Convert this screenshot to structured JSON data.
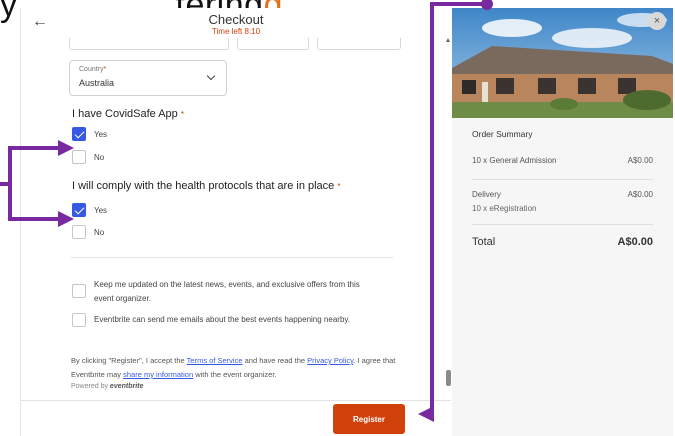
{
  "caption": {
    "pre": "y",
    "mid": "tering",
    "hl": "g"
  },
  "header": {
    "title": "Checkout",
    "timer": "Time left 8:10"
  },
  "country": {
    "label": "Country",
    "value": "Australia"
  },
  "questions": [
    {
      "label": "I have CovidSafe App",
      "options": [
        {
          "label": "Yes",
          "checked": true
        },
        {
          "label": "No",
          "checked": false
        }
      ]
    },
    {
      "label": "I will comply with the health protocols that are in place",
      "options": [
        {
          "label": "Yes",
          "checked": true
        },
        {
          "label": "No",
          "checked": false
        }
      ]
    }
  ],
  "consents": [
    {
      "line1": "Keep me updated on the latest news, events, and exclusive offers from this",
      "line2": "event organizer."
    },
    {
      "line1": "Eventbrite can send me emails about the best events happening nearby.",
      "line2": ""
    }
  ],
  "legal": {
    "t1": "By clicking \"Register\", I accept the ",
    "terms": "Terms of Service",
    "t2": " and have read the ",
    "privacy": "Privacy Policy",
    "t3": ". I agree that Eventbrite may ",
    "share": "share my information",
    "t4": " with the event organizer.",
    "powered": "Powered by",
    "brand": "eventbrite"
  },
  "register_label": "Register",
  "summary": {
    "title": "Order Summary",
    "items": [
      {
        "label": "10 x General Admission",
        "value": "A$0.00"
      },
      {
        "label": "Delivery",
        "value": "A$0.00",
        "sub": "10 x eRegistration"
      }
    ],
    "total_label": "Total",
    "total_value": "A$0.00"
  },
  "colors": {
    "brand": "#d1410c",
    "checkbox": "#3659e3",
    "annotation": "#7a2aa0"
  },
  "icons": {
    "back": "arrow-left-icon",
    "close": "close-icon",
    "dropdown": "chevron-down-icon",
    "check": "check-icon"
  }
}
